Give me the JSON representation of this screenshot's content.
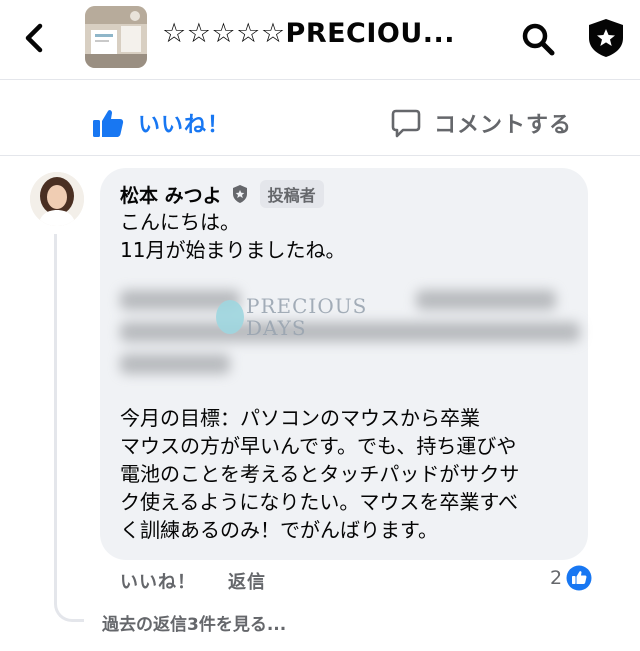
{
  "header": {
    "title": "☆☆☆☆☆PRECIOU..."
  },
  "actions": {
    "like_label": "いいね！",
    "comment_label": "コメントする"
  },
  "comment": {
    "author": "松本 みつよ",
    "role_badge": "投稿者",
    "lines_top": [
      "こんにちは。",
      "11月が始まりましたね。"
    ],
    "watermark": {
      "line1": "PRECIOUS",
      "line2": "DAYS"
    },
    "lines_bottom": [
      "今月の目標：パソコンのマウスから卒業",
      "マウスの方が早いんです。でも、持ち運びや",
      "電池のことを考えるとタッチパッドがサクサ",
      "ク使えるようになりたい。マウスを卒業すべ",
      "く訓練あるのみ！でがんばります。"
    ],
    "like_label": "いいね！",
    "reply_label": "返信",
    "reaction_count": "2",
    "view_replies": "過去の返信3件を見る..."
  },
  "colors": {
    "accent": "#1877f2",
    "secondary_text": "#65676b",
    "bubble": "#f0f2f5"
  },
  "icons": [
    "back-arrow-icon",
    "search-icon",
    "shield-star-icon",
    "thumbs-up-icon",
    "comment-icon",
    "verified-badge-icon"
  ]
}
